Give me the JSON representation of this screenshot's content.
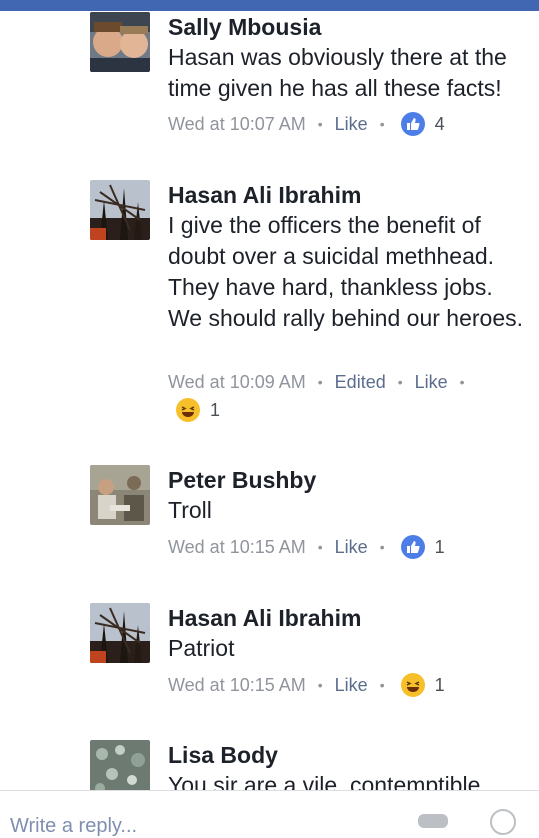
{
  "comments": [
    {
      "author": "Sally Mbousia",
      "text": "Hasan was obviously there at the time given he has all these facts!",
      "time": "Wed at 10:07 AM",
      "actions": [
        "Like"
      ],
      "reaction": {
        "type": "like",
        "count": "4"
      }
    },
    {
      "author": "Hasan Ali Ibrahim",
      "text": "I give the officers the benefit of doubt over a suicidal methhead. They have hard, thankless jobs. We should rally behind our heroes.",
      "time": "Wed at 10:09 AM",
      "actions": [
        "Edited",
        "Like"
      ],
      "reaction": {
        "type": "haha",
        "count": "1"
      }
    },
    {
      "author": "Peter Bushby",
      "text": "Troll",
      "time": "Wed at 10:15 AM",
      "actions": [
        "Like"
      ],
      "reaction": {
        "type": "like",
        "count": "1"
      }
    },
    {
      "author": "Hasan Ali Ibrahim",
      "text": "Patriot",
      "time": "Wed at 10:15 AM",
      "actions": [
        "Like"
      ],
      "reaction": {
        "type": "haha",
        "count": "1"
      }
    },
    {
      "author": "Lisa Body",
      "text": "You sir are a vile, contemptible"
    }
  ],
  "composer": {
    "placeholder": "Write a reply..."
  },
  "colors": {
    "brand": "#4267b2",
    "like": "#4d7ee8",
    "haha": "#f7c02a"
  }
}
